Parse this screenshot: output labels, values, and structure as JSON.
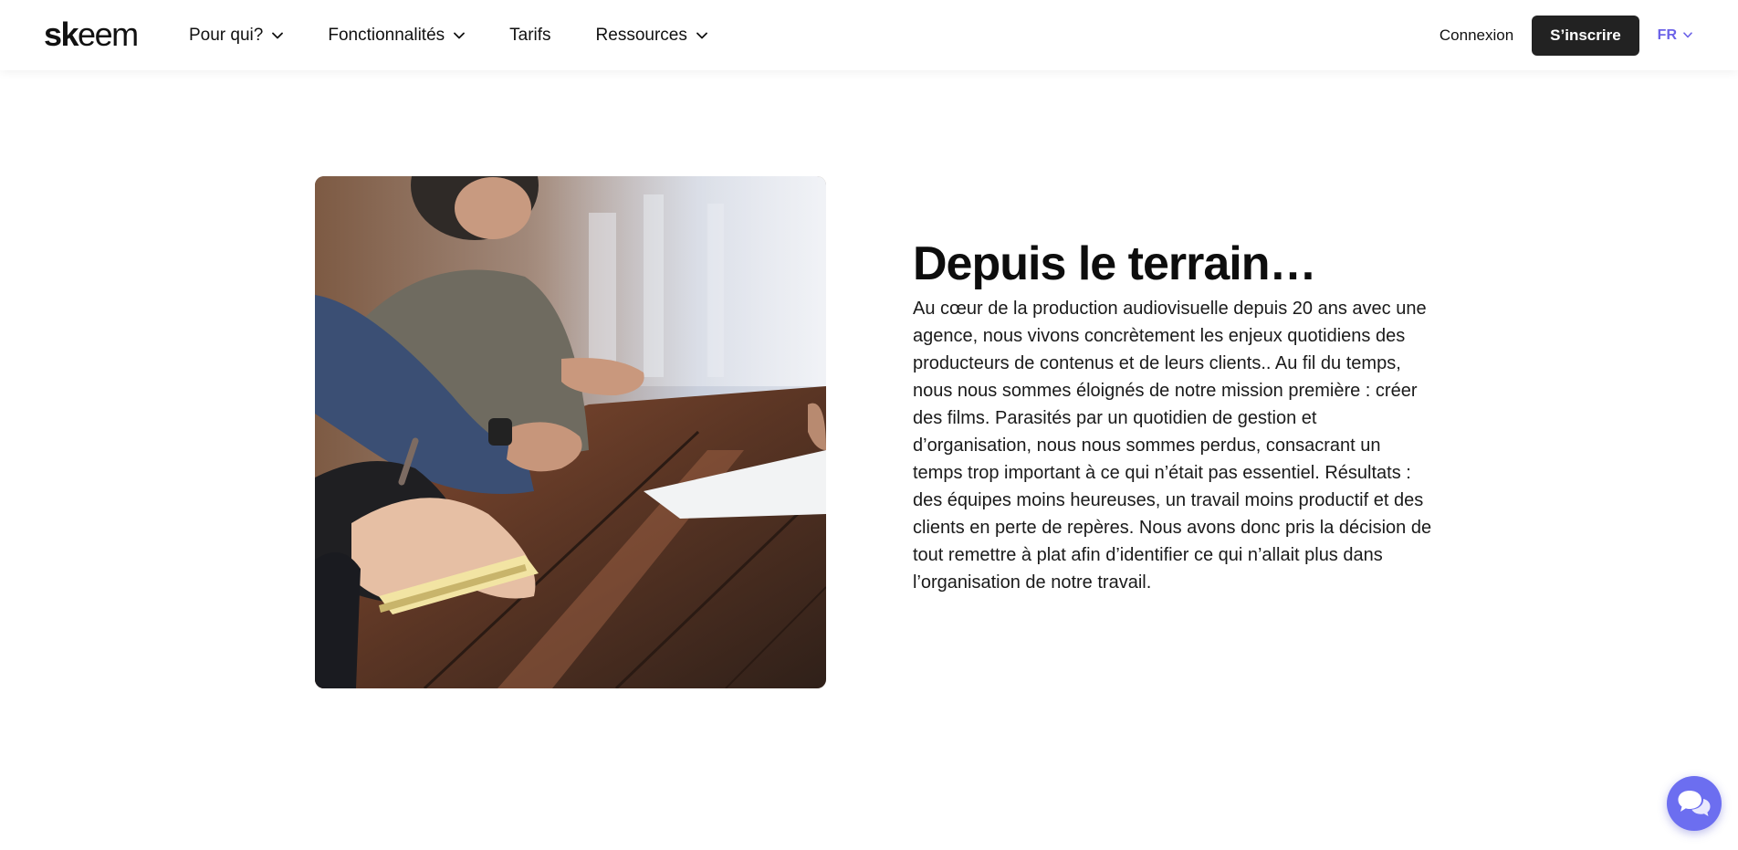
{
  "header": {
    "logo_bold": "sk",
    "logo_regular": "eem",
    "nav": [
      {
        "label": "Pour qui?",
        "has_dropdown": true
      },
      {
        "label": "Fonctionnalités",
        "has_dropdown": true
      },
      {
        "label": "Tarifs",
        "has_dropdown": false
      },
      {
        "label": "Ressources",
        "has_dropdown": true
      }
    ],
    "login_label": "Connexion",
    "signup_label": "S’inscrire",
    "language": "FR"
  },
  "section": {
    "image_alt": "Équipe prenant des notes autour d’une table en bois",
    "title": "Depuis le terrain…",
    "body": "Au cœur de la production audiovisuelle depuis 20 ans avec une agence, nous vivons concrètement les enjeux quotidiens des producteurs de contenus et de leurs clients.. Au fil du temps, nous nous sommes éloignés de notre mission première : créer des films. Parasités par un quotidien de gestion et d’organisation, nous nous sommes perdus, consacrant un temps trop important à ce qui n’était pas essentiel. Résultats : des équipes moins heureuses, un travail moins productif et des clients en perte de repères. Nous avons donc pris la décision de tout remettre à plat afin d’identifier ce qui n’allait plus dans l’organisation de notre travail."
  },
  "chat": {
    "icon": "chat-bubbles-icon"
  },
  "colors": {
    "accent": "#6c63e8",
    "signup_bg": "#222222",
    "chat_bg": "#6c6ef0"
  }
}
